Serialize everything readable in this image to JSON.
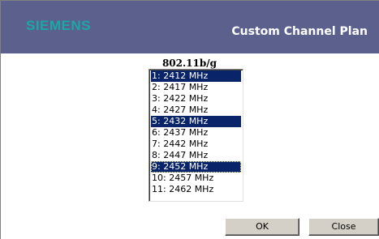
{
  "header": {
    "logo_text": "SIEMENS",
    "title": "Custom Channel Plan",
    "background": "#5b608d",
    "logo_color": "#19a8a8"
  },
  "channel_list": {
    "label": "802.11b/g",
    "options": [
      {
        "text": "1: 2412 MHz",
        "selected": true
      },
      {
        "text": "2: 2417 MHz",
        "selected": false
      },
      {
        "text": "3: 2422 MHz",
        "selected": false
      },
      {
        "text": "4: 2427 MHz",
        "selected": false
      },
      {
        "text": "5: 2432 MHz",
        "selected": true
      },
      {
        "text": "6: 2437 MHz",
        "selected": false
      },
      {
        "text": "7: 2442 MHz",
        "selected": false
      },
      {
        "text": "8: 2447 MHz",
        "selected": false
      },
      {
        "text": "9: 2452 MHz",
        "selected": true,
        "focused": true
      },
      {
        "text": "10: 2457 MHz",
        "selected": false
      },
      {
        "text": "11: 2462 MHz",
        "selected": false
      }
    ],
    "selection_color": "#0a246a"
  },
  "buttons": {
    "ok_label": "OK",
    "close_label": "Close"
  }
}
